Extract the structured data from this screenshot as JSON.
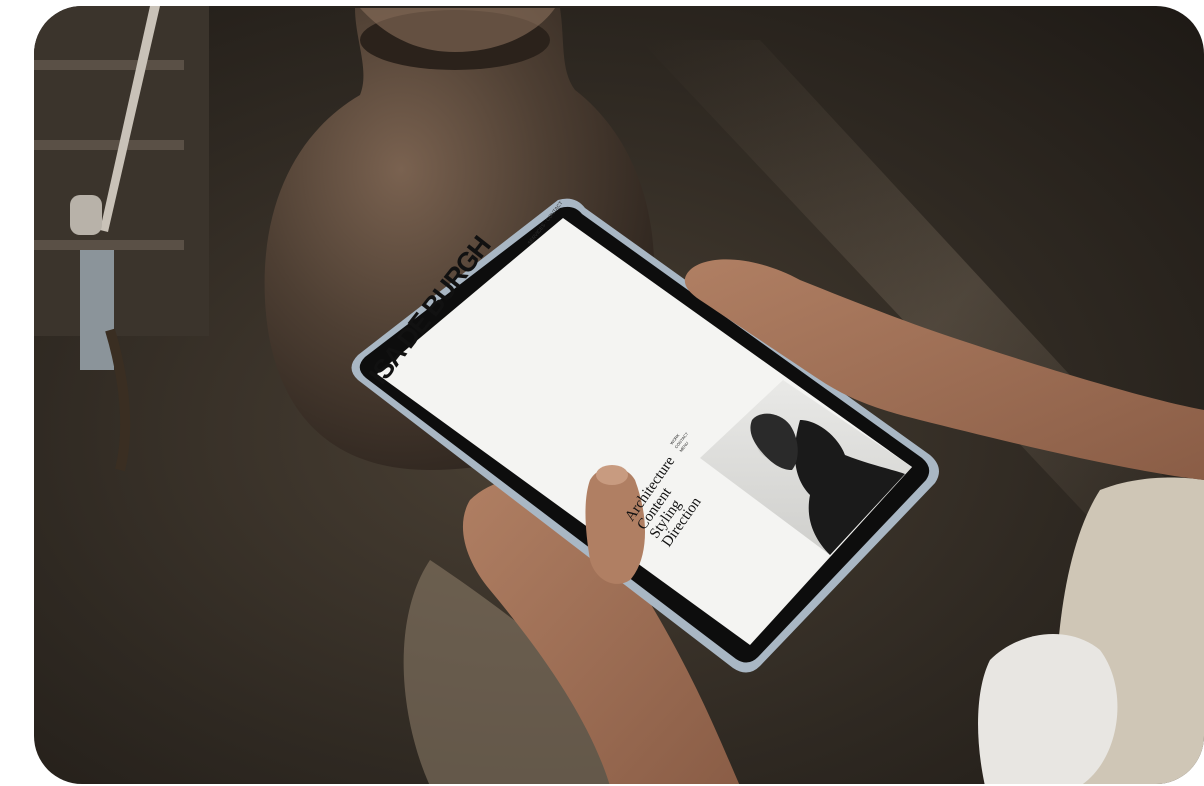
{
  "site": {
    "name": "ISA DE BURGH",
    "top_nav": "SERVICES · CONTACT",
    "side_menu": [
      "WORK",
      "CONTACT",
      "MENU"
    ],
    "services": [
      "Architecture",
      "Content",
      "Styling",
      "Direction"
    ]
  },
  "colors": {
    "background_dark": "#2b261f",
    "tablet_frame": "#a9b7c4",
    "screen": "#f4f4f2",
    "text": "#111111"
  }
}
